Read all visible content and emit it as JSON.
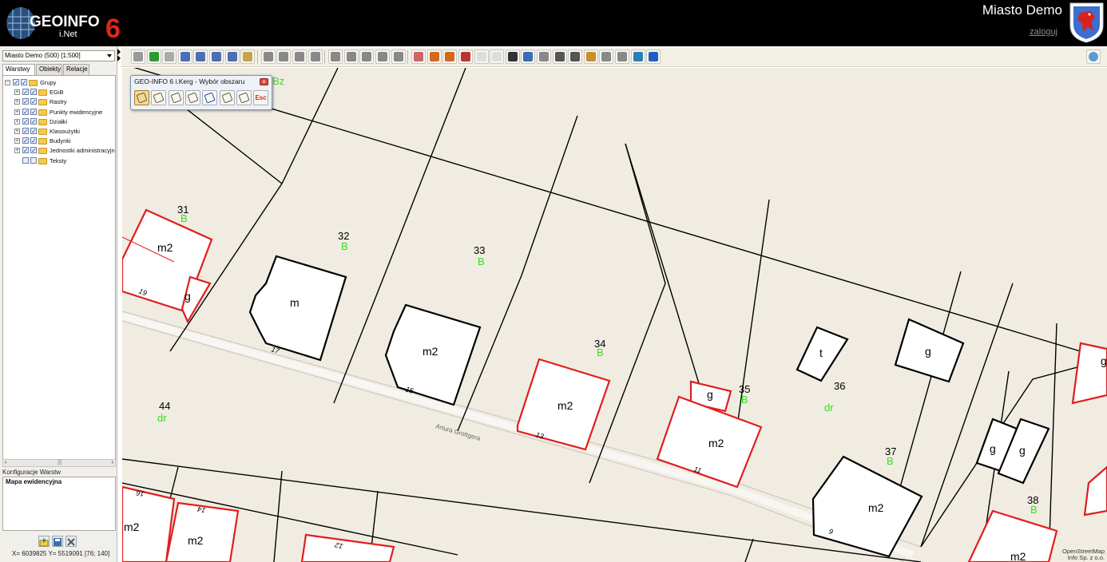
{
  "header": {
    "logo_text": "GEOINFO",
    "logo_sub": "i.Net",
    "logo_version": "6",
    "town_name": "Miasto Demo",
    "login_link": "zaloguj"
  },
  "left_panel": {
    "scale_select": "Miasto Demo (500) [1:500]",
    "tabs": [
      "Warstwy",
      "Obiekty",
      "Relacje"
    ],
    "tree": [
      {
        "label": "Grupy",
        "level": 0,
        "checked": true
      },
      {
        "label": "EGiB",
        "level": 1,
        "checked": true
      },
      {
        "label": "Rastry",
        "level": 1,
        "checked": true
      },
      {
        "label": "Punkty ewidencyjne",
        "level": 1,
        "checked": true
      },
      {
        "label": "Działki",
        "level": 1,
        "checked": true
      },
      {
        "label": "Klasoużytki",
        "level": 1,
        "checked": true
      },
      {
        "label": "Budynki",
        "level": 1,
        "checked": true
      },
      {
        "label": "Jednostki administracyjne",
        "level": 1,
        "checked": true
      },
      {
        "label": "Teksty",
        "level": 1,
        "checked": false
      }
    ],
    "config_title": "Konfiguracje Warstw",
    "config_item": "Mapa ewidencyjna",
    "coordinates": "X= 6039825 Y= 5519091 [76; 140]"
  },
  "dialog": {
    "title": "GEO-INFO 6 i.Kerg - Wybór obszaru",
    "esc_label": "Esc"
  },
  "map": {
    "plots": [
      {
        "num": "31",
        "use": "B"
      },
      {
        "num": "32",
        "use": "B"
      },
      {
        "num": "33",
        "use": "B"
      },
      {
        "num": "34",
        "use": "B"
      },
      {
        "num": "35",
        "use": "B"
      },
      {
        "num": "36",
        "use": "dr"
      },
      {
        "num": "37",
        "use": "B"
      },
      {
        "num": "38",
        "use": "B"
      },
      {
        "num": "44",
        "use": "dr"
      }
    ],
    "top_code": "Bz",
    "street_name": "Artura Grottgera",
    "buildings": [
      "m2",
      "g",
      "m",
      "m2",
      "m2",
      "m2",
      "g",
      "t",
      "g",
      "m2",
      "g",
      "g",
      "g",
      "m2",
      "m2",
      "m2"
    ],
    "house_numbers": [
      "19",
      "17",
      "15",
      "13",
      "11",
      "9",
      "16",
      "14",
      "12"
    ],
    "attribution": "OpenStreetMap\nInfo Sp. z o.o.",
    "colors": {
      "background": "#f0ece2",
      "parcel_line": "#000000",
      "building_red": "#e01e1e",
      "use_green": "#33e01c"
    }
  }
}
